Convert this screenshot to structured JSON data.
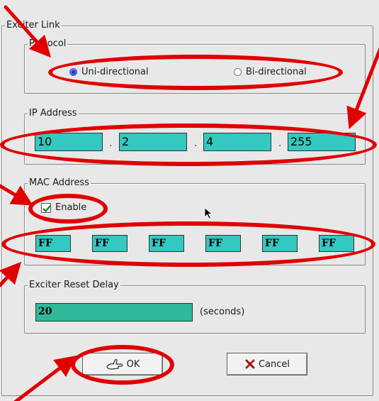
{
  "dialog": {
    "title": "Exciter Link",
    "protocol": {
      "label": "Protocol",
      "option1": "Uni-directional",
      "option2": "Bi-directional",
      "selected": "Uni-directional"
    },
    "ip": {
      "label": "IP Address",
      "octets": [
        "10",
        "2",
        "4",
        "255"
      ],
      "separator": "."
    },
    "mac": {
      "label": "MAC Address",
      "enable_label": "Enable",
      "enabled": true,
      "bytes": [
        "FF",
        "FF",
        "FF",
        "FF",
        "FF",
        "FF"
      ]
    },
    "reset": {
      "label": "Exciter Reset Delay",
      "value": "20",
      "unit": "(seconds)"
    },
    "buttons": {
      "ok": "OK",
      "cancel": "Cancel"
    }
  },
  "colors": {
    "field": "#33c8c0",
    "reset_field": "#2fb89a",
    "annotation": "#e00000"
  },
  "icons": {
    "ok": "ok-hand-icon",
    "cancel": "cancel-x-icon",
    "radio_selected": "radio-selected-icon",
    "checkbox": "checkmark-icon",
    "cursor": "mouse-pointer-icon"
  }
}
